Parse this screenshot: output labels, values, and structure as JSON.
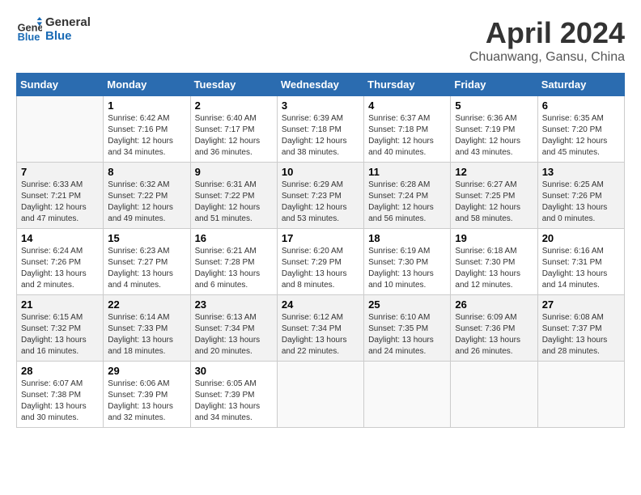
{
  "header": {
    "logo_line1": "General",
    "logo_line2": "Blue",
    "month": "April 2024",
    "location": "Chuanwang, Gansu, China"
  },
  "weekdays": [
    "Sunday",
    "Monday",
    "Tuesday",
    "Wednesday",
    "Thursday",
    "Friday",
    "Saturday"
  ],
  "weeks": [
    [
      {
        "day": "",
        "sunrise": "",
        "sunset": "",
        "daylight": ""
      },
      {
        "day": "1",
        "sunrise": "Sunrise: 6:42 AM",
        "sunset": "Sunset: 7:16 PM",
        "daylight": "Daylight: 12 hours and 34 minutes."
      },
      {
        "day": "2",
        "sunrise": "Sunrise: 6:40 AM",
        "sunset": "Sunset: 7:17 PM",
        "daylight": "Daylight: 12 hours and 36 minutes."
      },
      {
        "day": "3",
        "sunrise": "Sunrise: 6:39 AM",
        "sunset": "Sunset: 7:18 PM",
        "daylight": "Daylight: 12 hours and 38 minutes."
      },
      {
        "day": "4",
        "sunrise": "Sunrise: 6:37 AM",
        "sunset": "Sunset: 7:18 PM",
        "daylight": "Daylight: 12 hours and 40 minutes."
      },
      {
        "day": "5",
        "sunrise": "Sunrise: 6:36 AM",
        "sunset": "Sunset: 7:19 PM",
        "daylight": "Daylight: 12 hours and 43 minutes."
      },
      {
        "day": "6",
        "sunrise": "Sunrise: 6:35 AM",
        "sunset": "Sunset: 7:20 PM",
        "daylight": "Daylight: 12 hours and 45 minutes."
      }
    ],
    [
      {
        "day": "7",
        "sunrise": "Sunrise: 6:33 AM",
        "sunset": "Sunset: 7:21 PM",
        "daylight": "Daylight: 12 hours and 47 minutes."
      },
      {
        "day": "8",
        "sunrise": "Sunrise: 6:32 AM",
        "sunset": "Sunset: 7:22 PM",
        "daylight": "Daylight: 12 hours and 49 minutes."
      },
      {
        "day": "9",
        "sunrise": "Sunrise: 6:31 AM",
        "sunset": "Sunset: 7:22 PM",
        "daylight": "Daylight: 12 hours and 51 minutes."
      },
      {
        "day": "10",
        "sunrise": "Sunrise: 6:29 AM",
        "sunset": "Sunset: 7:23 PM",
        "daylight": "Daylight: 12 hours and 53 minutes."
      },
      {
        "day": "11",
        "sunrise": "Sunrise: 6:28 AM",
        "sunset": "Sunset: 7:24 PM",
        "daylight": "Daylight: 12 hours and 56 minutes."
      },
      {
        "day": "12",
        "sunrise": "Sunrise: 6:27 AM",
        "sunset": "Sunset: 7:25 PM",
        "daylight": "Daylight: 12 hours and 58 minutes."
      },
      {
        "day": "13",
        "sunrise": "Sunrise: 6:25 AM",
        "sunset": "Sunset: 7:26 PM",
        "daylight": "Daylight: 13 hours and 0 minutes."
      }
    ],
    [
      {
        "day": "14",
        "sunrise": "Sunrise: 6:24 AM",
        "sunset": "Sunset: 7:26 PM",
        "daylight": "Daylight: 13 hours and 2 minutes."
      },
      {
        "day": "15",
        "sunrise": "Sunrise: 6:23 AM",
        "sunset": "Sunset: 7:27 PM",
        "daylight": "Daylight: 13 hours and 4 minutes."
      },
      {
        "day": "16",
        "sunrise": "Sunrise: 6:21 AM",
        "sunset": "Sunset: 7:28 PM",
        "daylight": "Daylight: 13 hours and 6 minutes."
      },
      {
        "day": "17",
        "sunrise": "Sunrise: 6:20 AM",
        "sunset": "Sunset: 7:29 PM",
        "daylight": "Daylight: 13 hours and 8 minutes."
      },
      {
        "day": "18",
        "sunrise": "Sunrise: 6:19 AM",
        "sunset": "Sunset: 7:30 PM",
        "daylight": "Daylight: 13 hours and 10 minutes."
      },
      {
        "day": "19",
        "sunrise": "Sunrise: 6:18 AM",
        "sunset": "Sunset: 7:30 PM",
        "daylight": "Daylight: 13 hours and 12 minutes."
      },
      {
        "day": "20",
        "sunrise": "Sunrise: 6:16 AM",
        "sunset": "Sunset: 7:31 PM",
        "daylight": "Daylight: 13 hours and 14 minutes."
      }
    ],
    [
      {
        "day": "21",
        "sunrise": "Sunrise: 6:15 AM",
        "sunset": "Sunset: 7:32 PM",
        "daylight": "Daylight: 13 hours and 16 minutes."
      },
      {
        "day": "22",
        "sunrise": "Sunrise: 6:14 AM",
        "sunset": "Sunset: 7:33 PM",
        "daylight": "Daylight: 13 hours and 18 minutes."
      },
      {
        "day": "23",
        "sunrise": "Sunrise: 6:13 AM",
        "sunset": "Sunset: 7:34 PM",
        "daylight": "Daylight: 13 hours and 20 minutes."
      },
      {
        "day": "24",
        "sunrise": "Sunrise: 6:12 AM",
        "sunset": "Sunset: 7:34 PM",
        "daylight": "Daylight: 13 hours and 22 minutes."
      },
      {
        "day": "25",
        "sunrise": "Sunrise: 6:10 AM",
        "sunset": "Sunset: 7:35 PM",
        "daylight": "Daylight: 13 hours and 24 minutes."
      },
      {
        "day": "26",
        "sunrise": "Sunrise: 6:09 AM",
        "sunset": "Sunset: 7:36 PM",
        "daylight": "Daylight: 13 hours and 26 minutes."
      },
      {
        "day": "27",
        "sunrise": "Sunrise: 6:08 AM",
        "sunset": "Sunset: 7:37 PM",
        "daylight": "Daylight: 13 hours and 28 minutes."
      }
    ],
    [
      {
        "day": "28",
        "sunrise": "Sunrise: 6:07 AM",
        "sunset": "Sunset: 7:38 PM",
        "daylight": "Daylight: 13 hours and 30 minutes."
      },
      {
        "day": "29",
        "sunrise": "Sunrise: 6:06 AM",
        "sunset": "Sunset: 7:39 PM",
        "daylight": "Daylight: 13 hours and 32 minutes."
      },
      {
        "day": "30",
        "sunrise": "Sunrise: 6:05 AM",
        "sunset": "Sunset: 7:39 PM",
        "daylight": "Daylight: 13 hours and 34 minutes."
      },
      {
        "day": "",
        "sunrise": "",
        "sunset": "",
        "daylight": ""
      },
      {
        "day": "",
        "sunrise": "",
        "sunset": "",
        "daylight": ""
      },
      {
        "day": "",
        "sunrise": "",
        "sunset": "",
        "daylight": ""
      },
      {
        "day": "",
        "sunrise": "",
        "sunset": "",
        "daylight": ""
      }
    ]
  ]
}
